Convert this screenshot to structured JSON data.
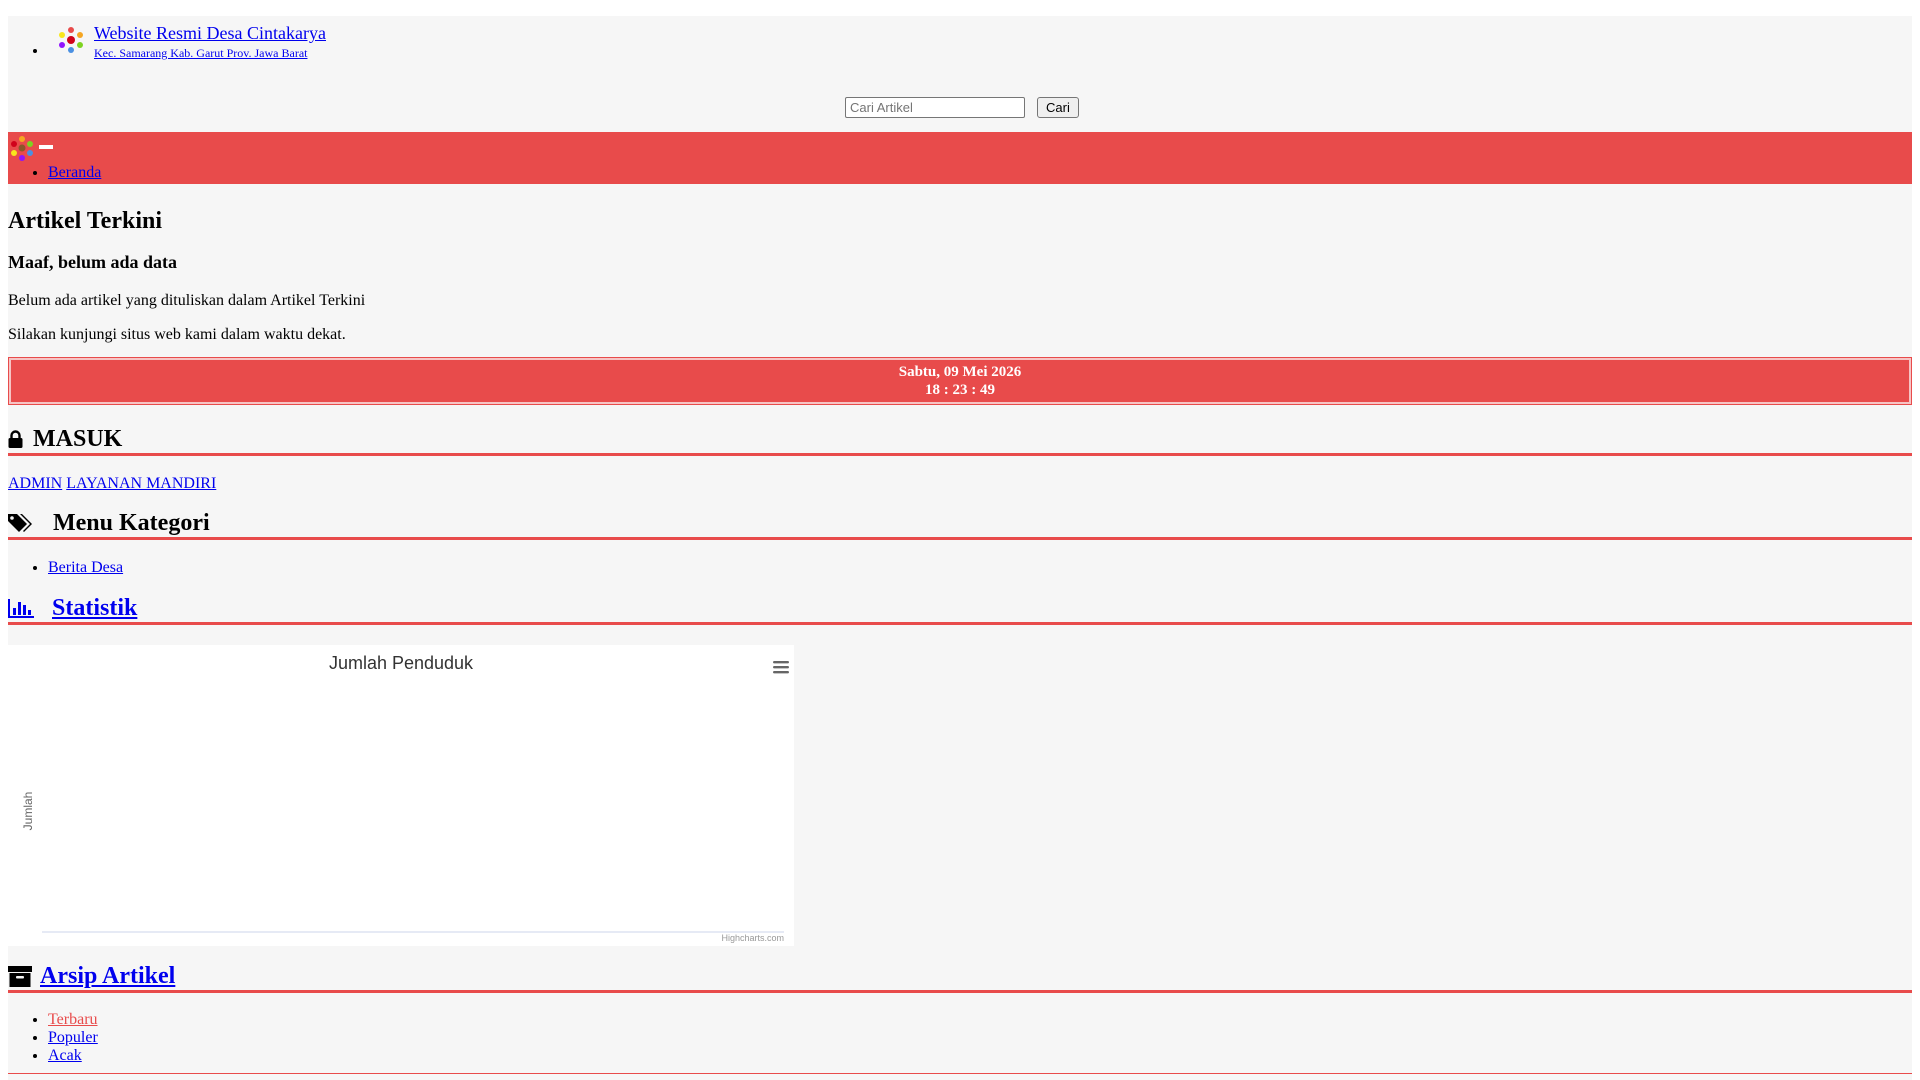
{
  "header": {
    "site_title": "Website Resmi Desa Cintakarya",
    "site_subtitle": "Kec. Samarang Kab. Garut Prov. Jawa Barat",
    "search_placeholder": "Cari Artikel",
    "search_button": "Cari"
  },
  "nav": {
    "items": [
      {
        "label": "Beranda"
      }
    ]
  },
  "articles": {
    "title": "Artikel Terkini",
    "empty_title": "Maaf, belum ada data",
    "empty_line1": "Belum ada artikel yang dituliskan dalam Artikel Terkini",
    "empty_line2": "Silakan kunjungi situs web kami dalam waktu dekat."
  },
  "datetime": {
    "date": "Sabtu, 09 Mei 2026",
    "time": "18 : 23 : 49"
  },
  "login": {
    "title": "MASUK",
    "admin_link": "ADMIN",
    "mandiri_link": "LAYANAN MANDIRI"
  },
  "category": {
    "title": "Menu Kategori",
    "items": [
      {
        "label": "Berita Desa"
      }
    ]
  },
  "stats": {
    "title": "Statistik"
  },
  "chart_data": {
    "type": "bar",
    "title": "Jumlah Penduduk",
    "ylabel": "Jumlah",
    "xlabel": "",
    "categories": [],
    "series": [],
    "credit": "Highcharts.com"
  },
  "archive": {
    "title": "Arsip Artikel",
    "tabs": [
      {
        "label": "Terbaru"
      },
      {
        "label": "Populer"
      },
      {
        "label": "Acak"
      }
    ]
  },
  "colors": {
    "accent": "#e84b4b",
    "page_bg": "#f6f6f6",
    "link": "#0000ee"
  }
}
